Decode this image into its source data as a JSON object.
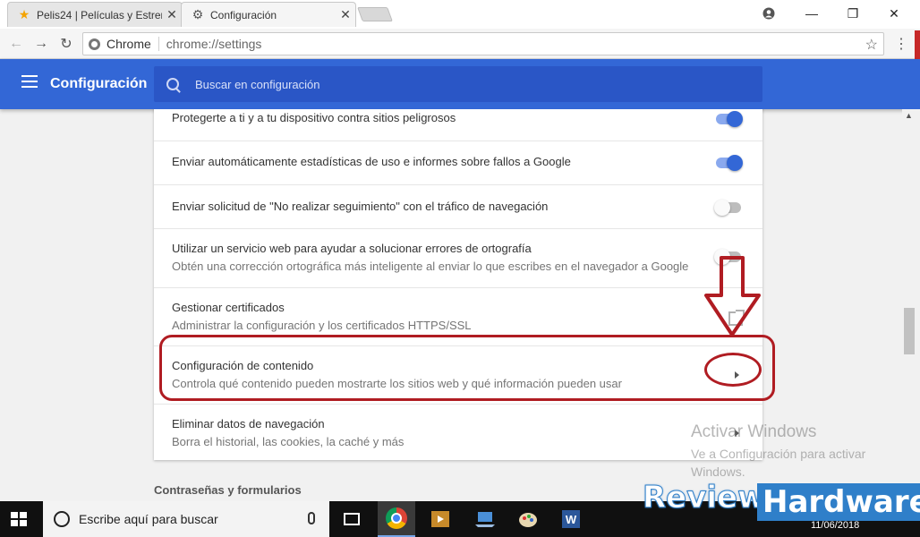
{
  "browser": {
    "tabs": [
      {
        "title": "Pelis24 | Películas y Estren",
        "icon": "star-icon",
        "active": false
      },
      {
        "title": "Configuración",
        "icon": "gear-icon",
        "active": true
      }
    ],
    "omnibox": {
      "chip": "Chrome",
      "url": "chrome://settings"
    }
  },
  "header": {
    "title": "Configuración",
    "search_placeholder": "Buscar en configuración"
  },
  "settings": {
    "rows": [
      {
        "title": "Protegerte a ti y a tu dispositivo contra sitios peligrosos",
        "subtitle": "",
        "control": "toggle",
        "on": true
      },
      {
        "title": "Enviar automáticamente estadísticas de uso e informes sobre fallos a Google",
        "subtitle": "",
        "control": "toggle",
        "on": true
      },
      {
        "title": "Enviar solicitud de \"No realizar seguimiento\" con el tráfico de navegación",
        "subtitle": "",
        "control": "toggle",
        "on": false
      },
      {
        "title": "Utilizar un servicio web para ayudar a solucionar errores de ortografía",
        "subtitle": "Obtén una corrección ortográfica más inteligente al enviar lo que escribes en el navegador a Google",
        "control": "toggle",
        "on": false
      },
      {
        "title": "Gestionar certificados",
        "subtitle": "Administrar la configuración y los certificados HTTPS/SSL",
        "control": "launch-icon"
      },
      {
        "title": "Configuración de contenido",
        "subtitle": "Controla qué contenido pueden mostrarte los sitios web y qué información pueden usar",
        "control": "arrow-right-icon"
      },
      {
        "title": "Eliminar datos de navegación",
        "subtitle": "Borra el historial, las cookies, la caché y más",
        "control": "arrow-right-icon"
      }
    ],
    "next_section_title": "Contraseñas y formularios"
  },
  "watermark": {
    "line1": "Activar Windows",
    "line2": "Ve a Configuración para activar Windows."
  },
  "taskbar": {
    "search_text": "Escribe aquí para buscar",
    "date": "11/06/2018"
  },
  "logo": {
    "part1": "Review",
    "part2": "Hardware"
  },
  "colors": {
    "accent": "#3367d6",
    "annotation": "#b01c22"
  }
}
